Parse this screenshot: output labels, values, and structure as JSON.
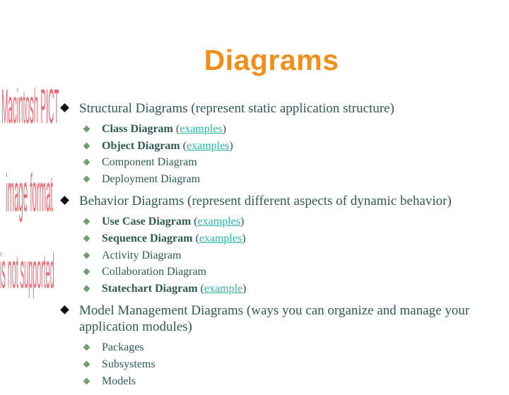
{
  "slide": {
    "title": "Diagrams",
    "placeholder_image": {
      "lines": [
        "Macintosh PICT",
        "image format",
        "is not supported"
      ]
    },
    "sections": [
      {
        "label": "Structural Diagrams (represent static application structure)",
        "items": [
          {
            "name": "Class Diagram",
            "bold": true,
            "open": " (",
            "link": "examples",
            "close": ")"
          },
          {
            "name": "Object Diagram",
            "bold": true,
            "open": " (",
            "link": "examples",
            "close": ")"
          },
          {
            "name": "Component Diagram",
            "bold": false
          },
          {
            "name": "Deployment Diagram",
            "bold": false
          }
        ]
      },
      {
        "label": "Behavior Diagrams (represent different aspects of dynamic behavior)",
        "items": [
          {
            "name": "Use Case Diagram",
            "bold": true,
            "open": " (",
            "link": "examples",
            "close": ")"
          },
          {
            "name": "Sequence Diagram",
            "bold": true,
            "open": " (",
            "link": "examples",
            "close": ")"
          },
          {
            "name": "Activity Diagram",
            "bold": false
          },
          {
            "name": "Collaboration Diagram",
            "bold": false
          },
          {
            "name": "Statechart Diagram",
            "bold": true,
            "open": " (",
            "link": "example",
            "close": ")"
          }
        ]
      },
      {
        "label": "Model Management Diagrams (ways you can organize and manage your application modules)",
        "items": [
          {
            "name": "Packages",
            "bold": false
          },
          {
            "name": "Subsystems",
            "bold": false
          },
          {
            "name": "Models",
            "bold": false
          }
        ]
      }
    ]
  },
  "colors": {
    "title": "#f18f1b",
    "text": "#2f5a52",
    "link": "#2ab5a8",
    "placeholder": "#ea6a74",
    "level1_bullet": "#111111",
    "level2_bullet": "#6f9f6f"
  }
}
